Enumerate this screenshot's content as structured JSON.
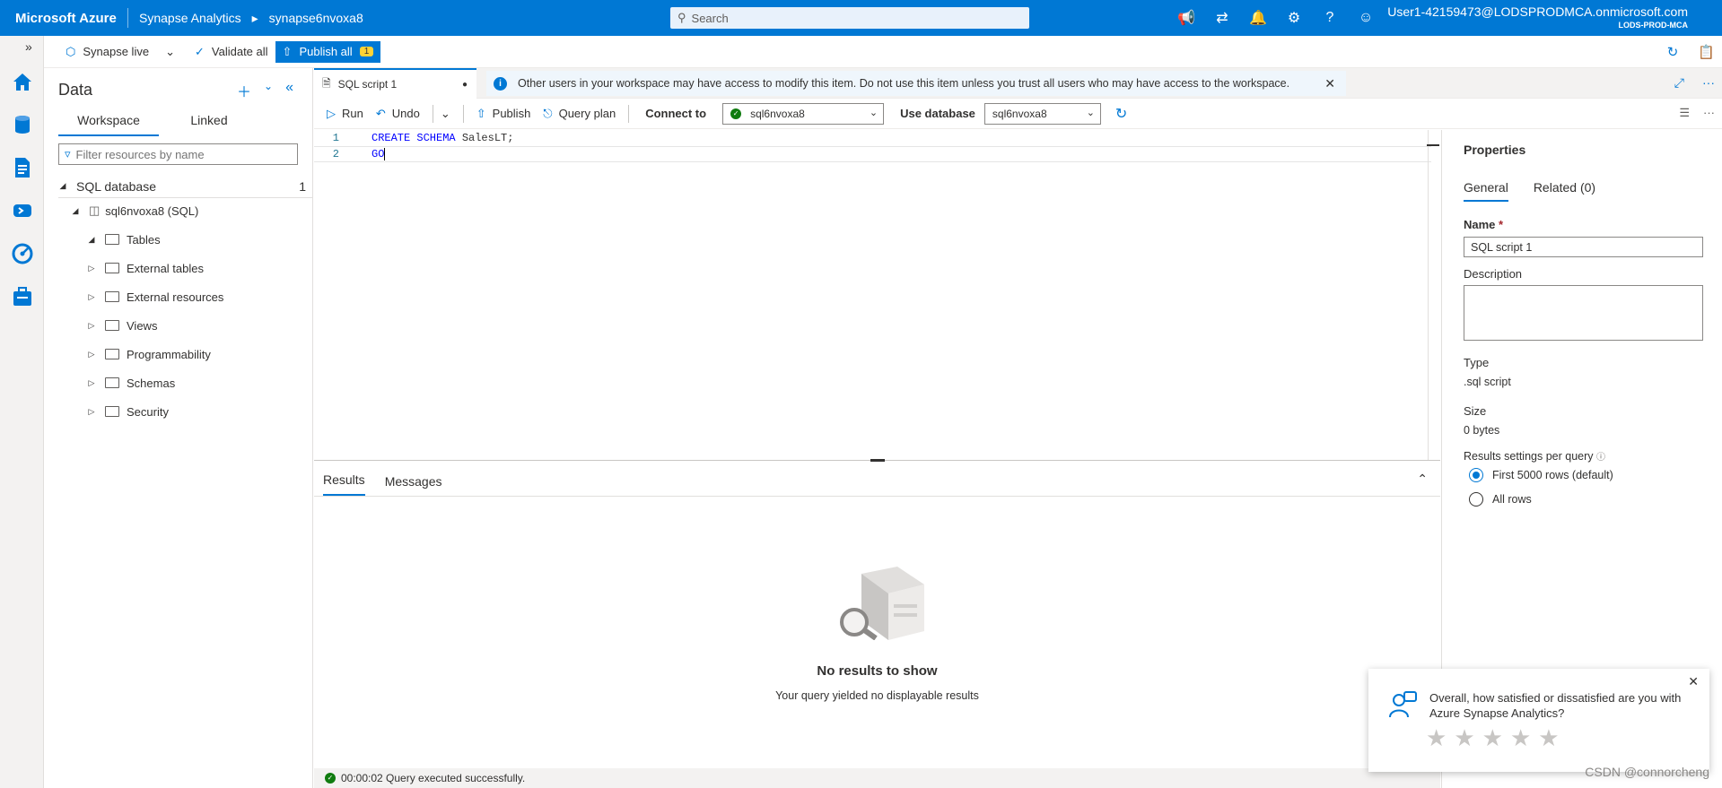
{
  "topbar": {
    "brand": "Microsoft Azure",
    "service": "Synapse Analytics",
    "workspace": "synapse6nvoxa8",
    "search_placeholder": "Search",
    "user": "User1-42159473@LODSPRODMCA.onmicrosoft.com",
    "tenant": "LODS-PROD-MCA"
  },
  "cmdbar": {
    "synapse_live": "Synapse live",
    "validate_all": "Validate all",
    "publish_all": "Publish all",
    "publish_count": "1"
  },
  "data_panel": {
    "title": "Data",
    "tabs": [
      "Workspace",
      "Linked"
    ],
    "filter_placeholder": "Filter resources by name",
    "sql_database": {
      "label": "SQL database",
      "count": "1"
    },
    "db_node": "sql6nvoxa8 (SQL)",
    "folders": [
      "Tables",
      "External tables",
      "External resources",
      "Views",
      "Programmability",
      "Schemas",
      "Security"
    ]
  },
  "script_tab": {
    "label": "SQL script 1",
    "info": "Other users in your workspace may have access to modify this item. Do not use this item unless you trust all users who may have access to the workspace."
  },
  "editor_toolbar": {
    "run": "Run",
    "undo": "Undo",
    "publish": "Publish",
    "query_plan": "Query plan",
    "connect_to_label": "Connect to",
    "connect_to_value": "sql6nvoxa8",
    "use_database_label": "Use database",
    "use_database_value": "sql6nvoxa8"
  },
  "code": {
    "lines": [
      {
        "num": "1",
        "kw": "CREATE SCHEMA",
        "rest": " SalesLT;"
      },
      {
        "num": "2",
        "kw": "GO",
        "rest": ""
      }
    ]
  },
  "results": {
    "tabs": [
      "Results",
      "Messages"
    ],
    "empty_title": "No results to show",
    "empty_sub": "Your query yielded no displayable results",
    "status": "00:00:02 Query executed successfully."
  },
  "properties": {
    "title": "Properties",
    "tabs": [
      "General",
      "Related (0)"
    ],
    "name_label": "Name",
    "name_value": "SQL script 1",
    "description_label": "Description",
    "type_label": "Type",
    "type_value": ".sql script",
    "size_label": "Size",
    "size_value": "0 bytes",
    "results_settings_label": "Results settings per query",
    "radio_options": [
      "First 5000 rows (default)",
      "All rows"
    ]
  },
  "feedback": {
    "question": "Overall, how satisfied or dissatisfied are you with Azure Synapse Analytics?"
  },
  "watermark": "CSDN @connorcheng",
  "colors": {
    "accent": "#0078d4",
    "success": "#107c10",
    "badge": "#ffd335"
  }
}
